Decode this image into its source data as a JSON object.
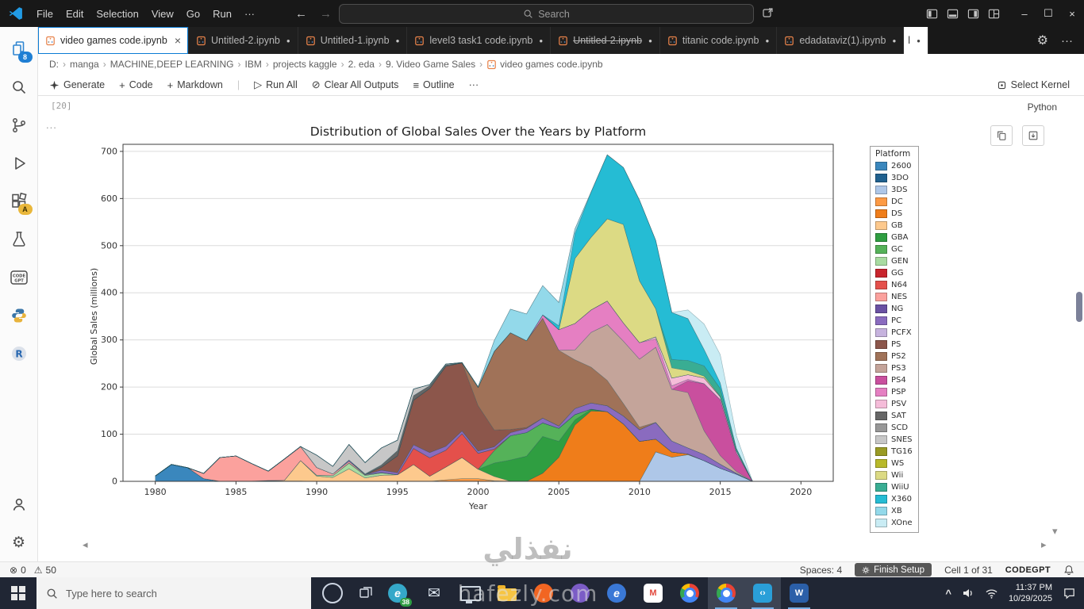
{
  "window": {
    "menus": [
      "File",
      "Edit",
      "Selection",
      "View",
      "Go",
      "Run"
    ],
    "menu_overflow": "···",
    "search_placeholder": "Search"
  },
  "tabs": [
    {
      "label": "video games code.ipynb",
      "active": true,
      "close": "×"
    },
    {
      "label": "Untitled-2.ipynb",
      "dot": "●"
    },
    {
      "label": "Untitled-1.ipynb",
      "dot": "●"
    },
    {
      "label": "level3 task1 code.ipynb",
      "dot": "●"
    },
    {
      "label": "Untitled-2.ipynb",
      "dot": "●",
      "strikethrough": true
    },
    {
      "label": "titanic code.ipynb",
      "dot": "●"
    },
    {
      "label": "edadataviz(1).ipynb",
      "dot": "●"
    },
    {
      "label": "l",
      "dot": "●",
      "partial": true
    }
  ],
  "breadcrumbs": [
    "D:",
    "manga",
    "MACHINE,DEEP LEARNING",
    "IBM",
    "projects kaggle",
    "2. eda",
    "9. Video Game Sales",
    "video games code.ipynb"
  ],
  "notebook_toolbar": {
    "generate": "Generate",
    "code": "Code",
    "markdown": "Markdown",
    "run_all": "Run All",
    "clear_outputs": "Clear All Outputs",
    "outline": "Outline",
    "more": "···",
    "select_kernel": "Select Kernel"
  },
  "cell": {
    "execution_count": "[20]",
    "language": "Python",
    "overflow": "..."
  },
  "activity_bar": {
    "files_badge": "8",
    "test_badge": "A"
  },
  "status_bar": {
    "errors": "0",
    "warnings": "50",
    "spaces": "Spaces: 4",
    "finish_setup": "Finish Setup",
    "cell_position": "Cell 1 of 31",
    "brand": "CODEGPT"
  },
  "taskbar": {
    "search_placeholder": "Type here to search",
    "clock_time": "11:37 PM",
    "clock_date": "10/29/2025",
    "apps": [
      {
        "name": "edge",
        "shape": "circle",
        "color": "#35a8c9",
        "glyph": "e",
        "glyph_color": "#ffffff",
        "badge": "38"
      },
      {
        "name": "mail",
        "shape": "glyph",
        "glyph": "✉",
        "color": "#dfe8f2"
      },
      {
        "name": "display",
        "shape": "monitor"
      },
      {
        "name": "explorer",
        "shape": "folder"
      },
      {
        "name": "firefox",
        "shape": "circle",
        "color": "#f26522"
      },
      {
        "name": "app-purple",
        "shape": "circle",
        "color": "#7b5cc6"
      },
      {
        "name": "edge-blue",
        "shape": "circle",
        "color": "#3a78d6",
        "glyph": "e",
        "glyph_color": "#ffffff"
      },
      {
        "name": "gmail",
        "shape": "square",
        "color": "#ffffff",
        "glyph": "M",
        "glyph_color": "#e2483d"
      },
      {
        "name": "chrome",
        "shape": "chrome"
      },
      {
        "name": "chrome-2",
        "shape": "chrome",
        "open": true,
        "highlight": true
      },
      {
        "name": "vscode",
        "shape": "square",
        "color": "#2a9fd8",
        "glyph": "‹›",
        "glyph_color": "#ffffff",
        "open": true,
        "highlight": true
      },
      {
        "name": "word",
        "shape": "square",
        "color": "#2b5fa8",
        "glyph": "W",
        "glyph_color": "#ffffff",
        "open": true
      }
    ]
  },
  "watermark": {
    "arabic": "نفذلي",
    "latin": "hafezly.com"
  },
  "chart_data": {
    "type": "area",
    "stacked": true,
    "title": "Distribution of Global Sales Over the Years by Platform",
    "xlabel": "Year",
    "ylabel": "Global Sales (millions)",
    "legend_title": "Platform",
    "legend_position": "right-outside",
    "grid": "horizontal-light",
    "xlim": [
      1978,
      2022
    ],
    "ylim": [
      0,
      715
    ],
    "xticks": [
      1980,
      1985,
      1990,
      1995,
      2000,
      2005,
      2010,
      2015,
      2020
    ],
    "yticks": [
      0,
      100,
      200,
      300,
      400,
      500,
      600,
      700
    ],
    "years": [
      1980,
      1981,
      1982,
      1983,
      1984,
      1985,
      1986,
      1987,
      1988,
      1989,
      1990,
      1991,
      1992,
      1993,
      1994,
      1995,
      1996,
      1997,
      1998,
      1999,
      2000,
      2001,
      2002,
      2003,
      2004,
      2005,
      2006,
      2007,
      2008,
      2009,
      2010,
      2011,
      2012,
      2013,
      2014,
      2015,
      2016,
      2017,
      2018,
      2019,
      2020
    ],
    "series": [
      {
        "name": "2600",
        "color": "#3a87bd",
        "data": {
          "1980": 11.4,
          "1981": 35.8,
          "1982": 28.9,
          "1983": 5.8,
          "1984": 0.3,
          "1985": 0.5,
          "1986": 0.7,
          "1987": 1.9,
          "1988": 0.8,
          "1989": 0.6
        }
      },
      {
        "name": "3DO",
        "color": "#20618f",
        "data": {
          "1994": 0.1,
          "1995": 0.1
        }
      },
      {
        "name": "3DS",
        "color": "#aec7e8",
        "data": {
          "2011": 62.5,
          "2012": 51.1,
          "2013": 56.6,
          "2014": 43.8,
          "2015": 27.8,
          "2016": 15.1
        }
      },
      {
        "name": "DC",
        "color": "#fd9a44",
        "data": {
          "1998": 3.4,
          "1999": 5.8,
          "2000": 5.7,
          "2001": 1.1,
          "2002": 0.4
        }
      },
      {
        "name": "DS",
        "color": "#ef7d1a",
        "data": {
          "2004": 17.3,
          "2005": 51.0,
          "2006": 119.8,
          "2007": 149.4,
          "2008": 147.9,
          "2009": 121.8,
          "2010": 85.0,
          "2011": 27.1,
          "2012": 11.0,
          "2013": 1.5,
          "2020": 0.3
        }
      },
      {
        "name": "GB",
        "color": "#fdc98d",
        "data": {
          "1988": 1.4,
          "1989": 43.4,
          "1990": 11.2,
          "1991": 8.2,
          "1992": 26.7,
          "1993": 7.3,
          "1994": 12.8,
          "1995": 13.9,
          "1996": 35.7,
          "1997": 10.9,
          "1998": 26.9,
          "1999": 44.6,
          "2000": 20.0,
          "2001": 9.2
        }
      },
      {
        "name": "GBA",
        "color": "#2f9e41",
        "data": {
          "2001": 28.6,
          "2002": 44.9,
          "2003": 53.4,
          "2004": 77.9,
          "2005": 33.9,
          "2006": 10.5,
          "2007": 3.4
        }
      },
      {
        "name": "GC",
        "color": "#55b259",
        "data": {
          "2001": 26.3,
          "2002": 51.4,
          "2003": 50.0,
          "2004": 28.8,
          "2005": 27.6,
          "2006": 11.3,
          "2007": 0.4
        }
      },
      {
        "name": "GEN",
        "color": "#a8dba1",
        "data": {
          "1990": 1.8,
          "1991": 3.9,
          "1992": 11.6,
          "1993": 5.4,
          "1994": 5.0
        }
      },
      {
        "name": "GG",
        "color": "#c9252d",
        "data": {
          "1992": 0.6
        }
      },
      {
        "name": "N64",
        "color": "#e4504b",
        "data": {
          "1996": 34.1,
          "1997": 39.0,
          "1998": 35.9,
          "1999": 50.7,
          "2000": 33.8,
          "2001": 3.3
        }
      },
      {
        "name": "NES",
        "color": "#fba19d",
        "data": {
          "1983": 11.0,
          "1984": 50.1,
          "1985": 53.4,
          "1986": 36.4,
          "1987": 19.8,
          "1988": 45.0,
          "1989": 29.8,
          "1990": 16.4,
          "1991": 3.5,
          "1992": 3.4,
          "1993": 1.3,
          "1994": 0.5
        }
      },
      {
        "name": "NG",
        "color": "#6a51a3",
        "data": {
          "1993": 0.5,
          "1994": 0.5,
          "1995": 0.2,
          "1996": 0.2
        }
      },
      {
        "name": "PC",
        "color": "#8a6bbf",
        "data": {
          "1992": 3.0,
          "1994": 4.9,
          "1995": 4.1,
          "1996": 7.4,
          "1997": 11.1,
          "1998": 8.2,
          "1999": 5.9,
          "2000": 4.7,
          "2001": 5.1,
          "2002": 6.6,
          "2003": 8.6,
          "2004": 10.2,
          "2005": 4.9,
          "2006": 12.9,
          "2007": 13.1,
          "2008": 12.4,
          "2009": 16.9,
          "2010": 24.3,
          "2011": 35.0,
          "2012": 23.5,
          "2013": 12.7,
          "2014": 13.3,
          "2015": 8.5,
          "2016": 2.1
        }
      },
      {
        "name": "PCFX",
        "color": "#c6b3de",
        "data": {
          "1996": 0.1
        }
      },
      {
        "name": "PS",
        "color": "#8c564b",
        "data": {
          "1994": 6.0,
          "1995": 35.9,
          "1996": 94.7,
          "1997": 136.1,
          "1998": 169.5,
          "1999": 144.6,
          "2000": 96.3,
          "2001": 35.5,
          "2002": 6.7,
          "2003": 2.2
        }
      },
      {
        "name": "PS2",
        "color": "#a07258",
        "data": {
          "2000": 39.1,
          "2001": 166.4,
          "2002": 205.4,
          "2003": 184.3,
          "2004": 211.8,
          "2005": 160.7,
          "2006": 103.4,
          "2007": 76.0,
          "2008": 53.8,
          "2009": 26.4,
          "2010": 5.6,
          "2011": 0.5
        }
      },
      {
        "name": "PS3",
        "color": "#c4a49a",
        "data": {
          "2006": 21.1,
          "2007": 73.8,
          "2008": 118.5,
          "2009": 132.3,
          "2010": 144.4,
          "2011": 159.4,
          "2012": 109.5,
          "2013": 117.4,
          "2014": 50.0,
          "2015": 18.2,
          "2016": 3.6
        }
      },
      {
        "name": "PS4",
        "color": "#c94f9e",
        "data": {
          "2013": 24.8,
          "2014": 100.0,
          "2015": 118.9,
          "2016": 39.2,
          "2017": 0.1
        }
      },
      {
        "name": "PSP",
        "color": "#e57fc2",
        "data": {
          "2004": 7.1,
          "2005": 43.8,
          "2006": 55.9,
          "2007": 47.7,
          "2008": 50.1,
          "2009": 38.7,
          "2010": 35.0,
          "2011": 17.8,
          "2012": 7.7,
          "2013": 3.1,
          "2014": 0.2
        }
      },
      {
        "name": "PSV",
        "color": "#f5bcd9",
        "data": {
          "2011": 4.2,
          "2012": 16.2,
          "2013": 10.1,
          "2014": 11.9,
          "2015": 6.1,
          "2016": 4.2
        }
      },
      {
        "name": "SAT",
        "color": "#666666",
        "data": {
          "1994": 4.4,
          "1995": 10.8,
          "1996": 9.6,
          "1997": 5.9,
          "1998": 2.9
        }
      },
      {
        "name": "SCD",
        "color": "#979797",
        "data": {
          "1993": 1.5,
          "1994": 0.4
        }
      },
      {
        "name": "SNES",
        "color": "#c7c7c7",
        "data": {
          "1990": 26.2,
          "1991": 16.2,
          "1992": 32.9,
          "1993": 23.7,
          "1994": 36.0,
          "1995": 22.1,
          "1996": 14.1,
          "1997": 2.3,
          "1998": 2.1
        }
      },
      {
        "name": "TG16",
        "color": "#9a9b24",
        "data": {
          "1995": 0.2
        }
      },
      {
        "name": "WS",
        "color": "#b8b92a",
        "data": {
          "1999": 0.5,
          "2000": 0.5,
          "2001": 0.4
        }
      },
      {
        "name": "Wii",
        "color": "#dcda84",
        "data": {
          "2006": 137.9,
          "2007": 154.0,
          "2008": 174.2,
          "2009": 208.9,
          "2010": 131.0,
          "2011": 59.7,
          "2012": 21.8,
          "2013": 8.6,
          "2014": 3.8,
          "2015": 1.1
        }
      },
      {
        "name": "WiiU",
        "color": "#39ad93",
        "data": {
          "2012": 17.6,
          "2013": 21.8,
          "2014": 22.0,
          "2015": 16.4,
          "2016": 4.7
        }
      },
      {
        "name": "X360",
        "color": "#25bcd4",
        "data": {
          "2005": 8.3,
          "2006": 52.7,
          "2007": 95.9,
          "2008": 135.8,
          "2009": 120.9,
          "2010": 171.1,
          "2011": 145.1,
          "2012": 100.0,
          "2013": 88.6,
          "2014": 34.7,
          "2015": 11.9,
          "2016": 1.5
        }
      },
      {
        "name": "XB",
        "color": "#93d9ea",
        "data": {
          "2000": 1.0,
          "2001": 22.8,
          "2002": 49.8,
          "2003": 56.7,
          "2004": 62.2,
          "2005": 49.1,
          "2006": 10.0,
          "2007": 0.6,
          "2008": 0.2
        }
      },
      {
        "name": "XOne",
        "color": "#c9ecf4",
        "data": {
          "2013": 18.6,
          "2014": 54.1,
          "2015": 60.1,
          "2016": 26.2,
          "2017": 0.1
        }
      }
    ]
  }
}
